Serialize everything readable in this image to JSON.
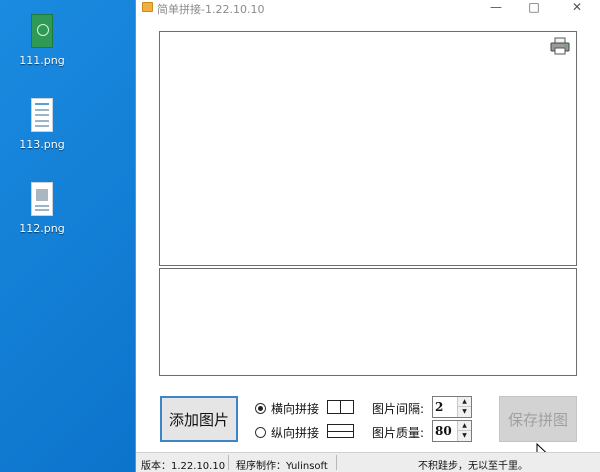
{
  "desktop": {
    "icons": [
      {
        "label": "111.png"
      },
      {
        "label": "113.png"
      },
      {
        "label": "112.png"
      }
    ]
  },
  "window": {
    "title": "简单拼接-1.22.10.10",
    "minimize": "—",
    "maximize": "□",
    "close": "✕"
  },
  "controls": {
    "add_image": "添加图片",
    "horizontal": "横向拼接",
    "vertical": "纵向拼接",
    "spacing_label": "图片间隔:",
    "spacing_value": "2",
    "quality_label": "图片质量:",
    "quality_value": "80",
    "save": "保存拼图",
    "spin_up": "▲",
    "spin_down": "▼"
  },
  "status": {
    "version": "版本：1.22.10.10",
    "author": "程序制作：Yulinsoft",
    "motto": "不积跬步，无以至千里。"
  },
  "colors": {
    "desktop": "#0f7fd6",
    "primary_border": "#3b86c9",
    "disabled_text": "#a0a0a0"
  }
}
